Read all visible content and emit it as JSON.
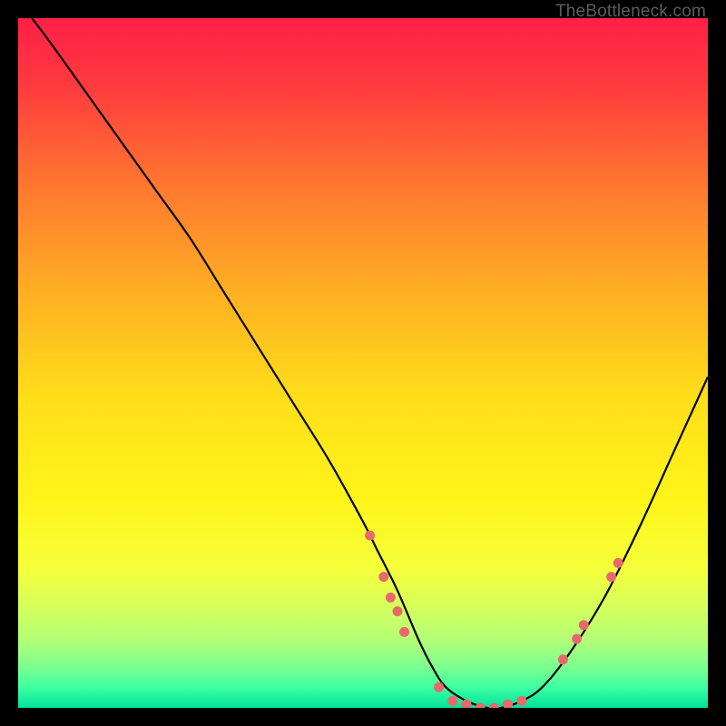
{
  "watermark": {
    "text": "TheBottleneck.com"
  },
  "chart_data": {
    "type": "line",
    "title": "",
    "xlabel": "",
    "ylabel": "",
    "xlim": [
      0,
      100
    ],
    "ylim": [
      0,
      100
    ],
    "grid": false,
    "legend": false,
    "background_gradient": {
      "stops": [
        {
          "offset": 0.0,
          "color": "#ff1f46"
        },
        {
          "offset": 0.1,
          "color": "#ff3b3e"
        },
        {
          "offset": 0.25,
          "color": "#ff7a2f"
        },
        {
          "offset": 0.4,
          "color": "#ffb022"
        },
        {
          "offset": 0.55,
          "color": "#ffde1a"
        },
        {
          "offset": 0.7,
          "color": "#fff51a"
        },
        {
          "offset": 0.8,
          "color": "#f4ff3a"
        },
        {
          "offset": 0.85,
          "color": "#d8ff5a"
        },
        {
          "offset": 0.9,
          "color": "#b4ff76"
        },
        {
          "offset": 0.94,
          "color": "#7dff8f"
        },
        {
          "offset": 0.97,
          "color": "#3effa0"
        },
        {
          "offset": 1.0,
          "color": "#00e29e"
        }
      ]
    },
    "series": [
      {
        "name": "bottleneck-curve",
        "color": "#000000",
        "x": [
          2,
          5,
          10,
          15,
          20,
          25,
          30,
          35,
          40,
          45,
          50,
          52,
          55,
          58,
          60,
          62,
          65,
          68,
          70,
          73,
          76,
          80,
          85,
          90,
          95,
          100
        ],
        "y": [
          100,
          96,
          89,
          82,
          75,
          68,
          60,
          52,
          44,
          36,
          27,
          23,
          17,
          10,
          6,
          3,
          1,
          0,
          0,
          1,
          3,
          8,
          16,
          26,
          37,
          48
        ]
      }
    ],
    "scatter": {
      "name": "highlight-points",
      "color": "#e66a6a",
      "radius": 5.5,
      "points": [
        {
          "x": 51,
          "y": 25
        },
        {
          "x": 53,
          "y": 19
        },
        {
          "x": 54,
          "y": 16
        },
        {
          "x": 55,
          "y": 14
        },
        {
          "x": 56,
          "y": 11
        },
        {
          "x": 61,
          "y": 3
        },
        {
          "x": 63,
          "y": 1
        },
        {
          "x": 65,
          "y": 0.5
        },
        {
          "x": 67,
          "y": 0
        },
        {
          "x": 69,
          "y": 0
        },
        {
          "x": 71,
          "y": 0.5
        },
        {
          "x": 73,
          "y": 1
        },
        {
          "x": 79,
          "y": 7
        },
        {
          "x": 81,
          "y": 10
        },
        {
          "x": 82,
          "y": 12
        },
        {
          "x": 86,
          "y": 19
        },
        {
          "x": 87,
          "y": 21
        }
      ]
    }
  }
}
